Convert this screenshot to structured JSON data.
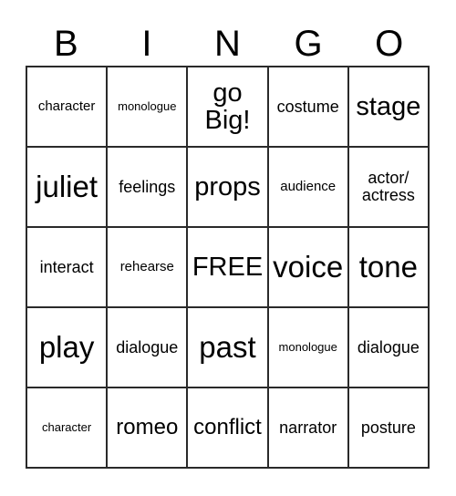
{
  "card": {
    "title": "BINGO",
    "header_letters": [
      "B",
      "I",
      "N",
      "G",
      "O"
    ],
    "grid_size": "5x5",
    "free_space_label": "FREE",
    "colors": {
      "background": "#ffffff",
      "border": "#2a2a2a",
      "text": "#000000"
    },
    "rows": [
      [
        {
          "text": "character",
          "size": "sz-s"
        },
        {
          "text": "monologue",
          "size": "sz-xs"
        },
        {
          "text": "go\nBig!",
          "size": "sz-xl"
        },
        {
          "text": "costume",
          "size": "sz-m"
        },
        {
          "text": "stage",
          "size": "sz-xl"
        }
      ],
      [
        {
          "text": "juliet",
          "size": "sz-xxl"
        },
        {
          "text": "feelings",
          "size": "sz-m"
        },
        {
          "text": "props",
          "size": "sz-xl"
        },
        {
          "text": "audience",
          "size": "sz-s"
        },
        {
          "text": "actor/\nactress",
          "size": "sz-m"
        }
      ],
      [
        {
          "text": "interact",
          "size": "sz-m"
        },
        {
          "text": "rehearse",
          "size": "sz-s"
        },
        {
          "text": "FREE",
          "size": "sz-xl"
        },
        {
          "text": "voice",
          "size": "sz-xxl"
        },
        {
          "text": "tone",
          "size": "sz-xxl"
        }
      ],
      [
        {
          "text": "play",
          "size": "sz-xxl"
        },
        {
          "text": "dialogue",
          "size": "sz-m"
        },
        {
          "text": "past",
          "size": "sz-xxl"
        },
        {
          "text": "monologue",
          "size": "sz-xs"
        },
        {
          "text": "dialogue",
          "size": "sz-m"
        }
      ],
      [
        {
          "text": "character",
          "size": "sz-xs"
        },
        {
          "text": "romeo",
          "size": "sz-l"
        },
        {
          "text": "conflict",
          "size": "sz-l"
        },
        {
          "text": "narrator",
          "size": "sz-m"
        },
        {
          "text": "posture",
          "size": "sz-m"
        }
      ]
    ]
  }
}
